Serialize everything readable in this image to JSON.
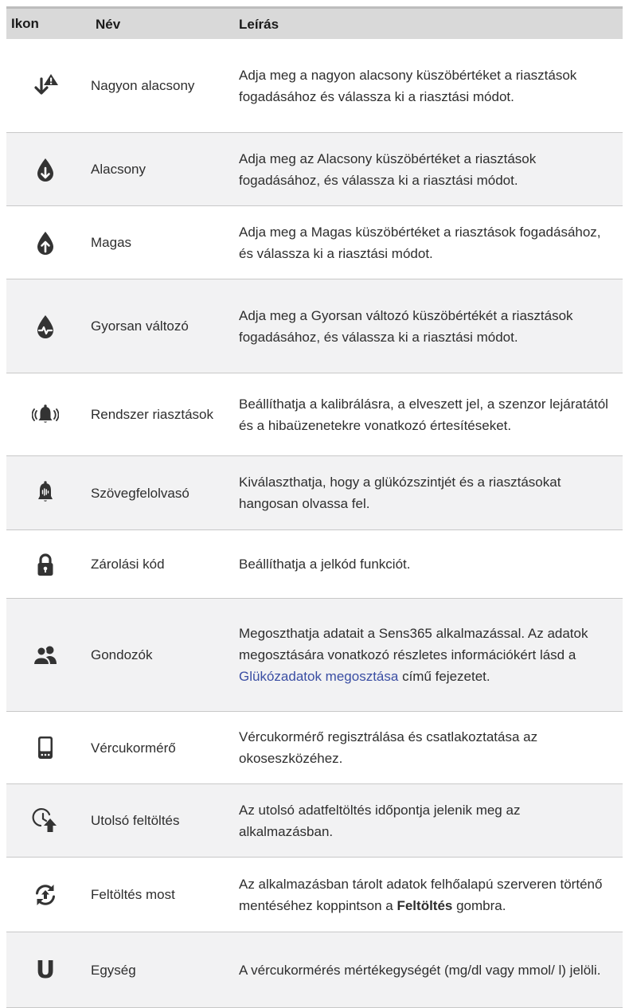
{
  "header": {
    "icon": "Ikon",
    "name": "Név",
    "description": "Leírás"
  },
  "rows": [
    {
      "icon": "very-low-alert-icon",
      "name": "Nagyon alacsony",
      "desc": "Adja meg a nagyon alacsony küszöbértéket a riasztások fogadásához és válassza ki a riasztási módot."
    },
    {
      "icon": "low-drop-icon",
      "name": "Alacsony",
      "desc": "Adja meg az Alacsony küszöbértéket a riasztások fogadásához, és válassza ki a riasztási módot."
    },
    {
      "icon": "high-drop-icon",
      "name": "Magas",
      "desc": "Adja meg a Magas küszöbértéket a riasztások fogadásához, és válassza ki a riasztási módot."
    },
    {
      "icon": "rapid-change-drop-icon",
      "name": "Gyorsan változó",
      "desc": "Adja meg a Gyorsan változó küszöbértékét a riasztások fogadásához, és válassza ki a riasztási módot."
    },
    {
      "icon": "system-alert-bell-icon",
      "name": "Rendszer riasztások",
      "desc": "Beállíthatja a kalibrálásra, a elveszett jel, a szenzor lejáratától és a hibaüzenetekre vonatkozó értesítéseket."
    },
    {
      "icon": "voice-bell-icon",
      "name": "Szövegfelolvasó",
      "desc": "Kiválaszthatja, hogy a glükózszintjét és a riasztásokat hangosan olvassa fel."
    },
    {
      "icon": "lock-icon",
      "name": "Zárolási kód",
      "desc": "Beállíthatja a jelkód funkciót."
    },
    {
      "icon": "caregivers-icon",
      "name": "Gondozók",
      "desc_parts": [
        "Megoszthatja adatait a Sens365 alkalmazással. Az adatok megosztására vonatkozó részletes információkért lásd a ",
        "Glükózadatok megosztása",
        " című fejezetet."
      ]
    },
    {
      "icon": "glucose-meter-icon",
      "name": "Vércukormérő",
      "desc": "Vércukormérő regisztrálása és csatlakoztatása az okoseszközéhez."
    },
    {
      "icon": "last-upload-icon",
      "name": "Utolsó feltöltés",
      "desc": "Az utolsó adatfeltöltés időpontja jelenik meg az alkalmazásban."
    },
    {
      "icon": "upload-now-icon",
      "name": "Feltöltés most",
      "desc_parts": [
        "Az alkalmazásban tárolt adatok felhőalapú szerveren történő mentéséhez koppintson a ",
        "Feltöltés",
        " gombra."
      ]
    },
    {
      "icon": "unit-icon",
      "name": "Egység",
      "desc": "A vércukormérés mértékegységét (mg/dl vagy mmol/ l) jelöli.",
      "icon_text": "U"
    }
  ]
}
